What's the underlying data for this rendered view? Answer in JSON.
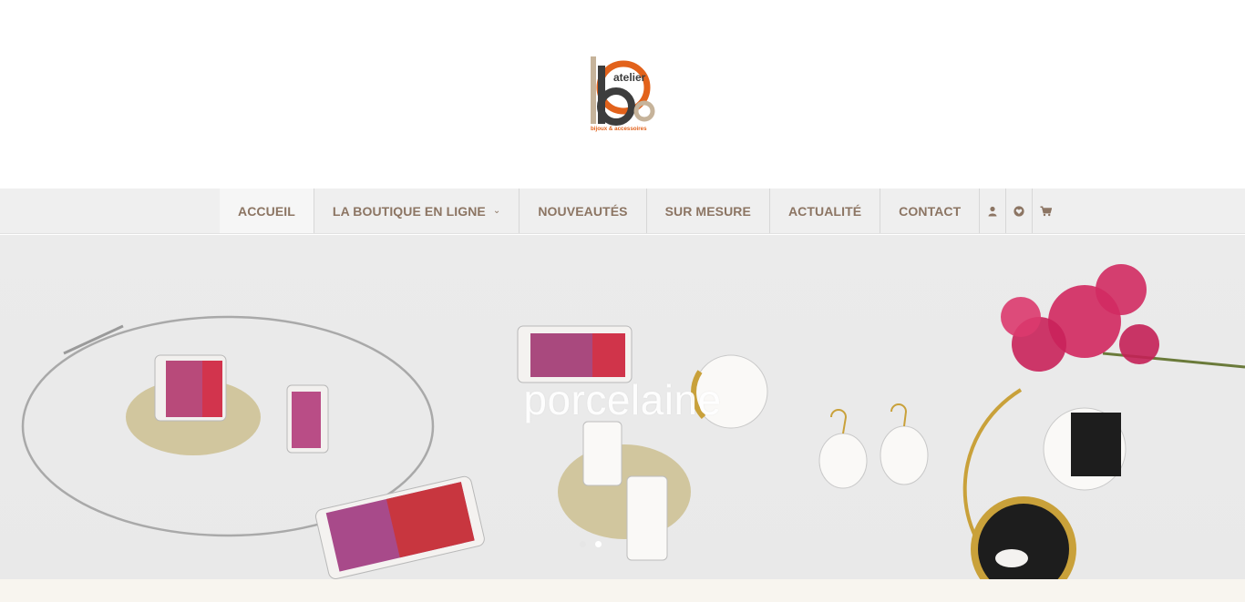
{
  "brand": {
    "word_top": "atelier",
    "word_bottom": "bijoux & accessoires",
    "colors": {
      "orange": "#e2621b",
      "taupe": "#c6b39a",
      "dark": "#3d3d3d"
    }
  },
  "nav": {
    "items": [
      {
        "label": "ACCUEIL"
      },
      {
        "label": "LA BOUTIQUE EN LIGNE"
      },
      {
        "label": "NOUVEAUTÉS"
      },
      {
        "label": "SUR MESURE"
      },
      {
        "label": "ACTUALITÉ"
      },
      {
        "label": "CONTACT"
      }
    ],
    "icons": [
      "user-icon",
      "heart-icon",
      "cart-icon"
    ],
    "text_color": "#8c7563"
  },
  "hero": {
    "title": "porcelaine",
    "slides_count": 2,
    "active_slide": 2
  }
}
